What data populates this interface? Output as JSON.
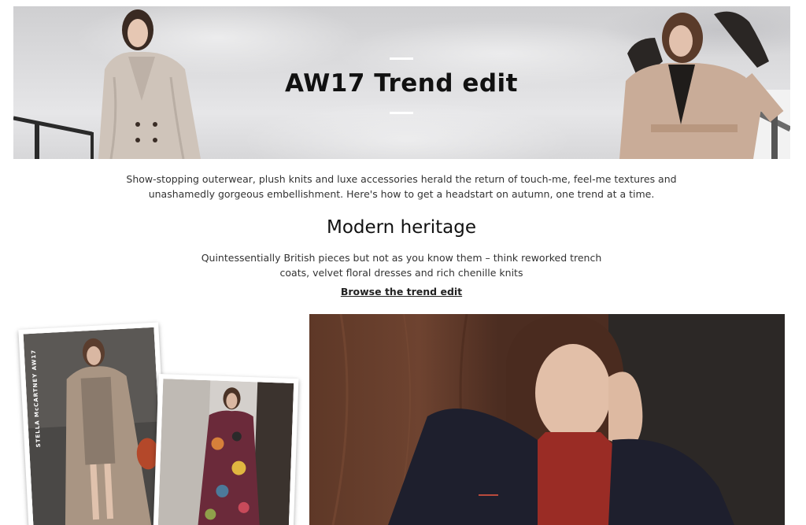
{
  "hero": {
    "title": "AW17 Trend edit"
  },
  "intro": {
    "text": "Show-stopping outerwear, plush knits and luxe accessories herald the return of touch-me, feel-me textures and unashamedly gorgeous embellishment. Here's how to get a headstart on autumn, one trend at a time."
  },
  "section": {
    "title": "Modern heritage",
    "description": "Quintessentially British pieces but not as you know them – think reworked trench coats, velvet floral dresses and rich chenille knits",
    "link_label": "Browse the trend edit"
  },
  "polaroids": {
    "caption_1": "STELLA McCARTNEY AW17"
  },
  "colors": {
    "accent_text": "#111111",
    "body_text": "#333333",
    "hero_bg": "#dcdcde"
  }
}
